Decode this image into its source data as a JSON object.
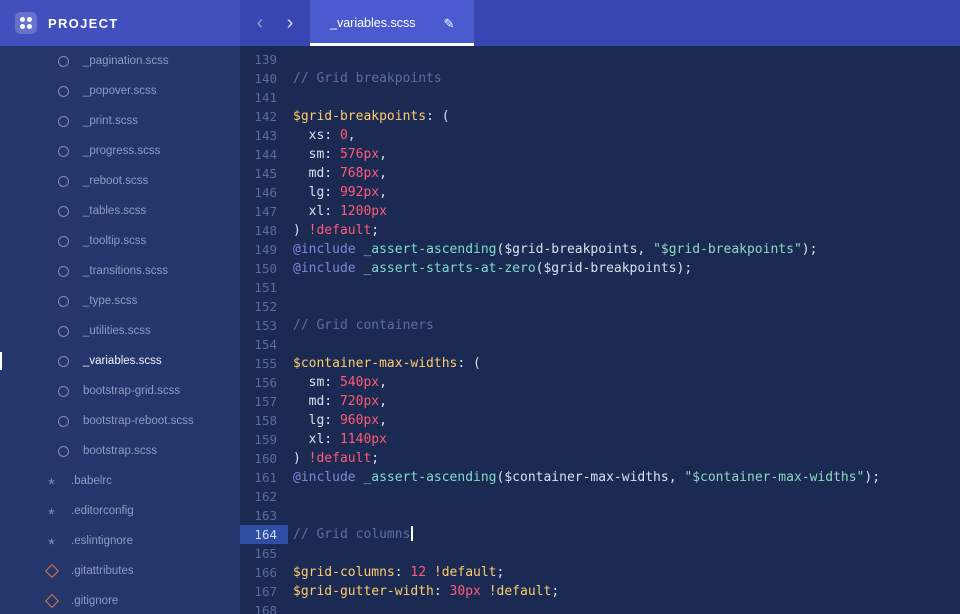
{
  "colors": {
    "header_left_bg": "#4250BE",
    "header_right_bg": "#3945B0",
    "active_tab_bg": "#4C5AD0",
    "tab_underline": "#FFFFFF",
    "sidebar_bg": "#24366B",
    "editor_bg": "#1B2A52",
    "active_line_gutter_bg": "#2E4DA3",
    "syntax_comment": "#5C6E9E",
    "syntax_variable": "#FFCB6B",
    "syntax_number": "#FF5B76",
    "syntax_atrule": "#7C88E0",
    "syntax_function": "#7FDBCA",
    "syntax_string": "#8FD7C2",
    "git_icon_color": "#D97745"
  },
  "header": {
    "project_label": "PROJECT",
    "back_icon": "‹",
    "forward_icon": "›",
    "tab_label": "_variables.scss",
    "pencil_icon": "✎"
  },
  "sidebar": {
    "files": [
      {
        "name": "_pagination.scss",
        "icon": "sass-icon",
        "depth": 1,
        "active": false
      },
      {
        "name": "_popover.scss",
        "icon": "sass-icon",
        "depth": 1,
        "active": false
      },
      {
        "name": "_print.scss",
        "icon": "sass-icon",
        "depth": 1,
        "active": false
      },
      {
        "name": "_progress.scss",
        "icon": "sass-icon",
        "depth": 1,
        "active": false
      },
      {
        "name": "_reboot.scss",
        "icon": "sass-icon",
        "depth": 1,
        "active": false
      },
      {
        "name": "_tables.scss",
        "icon": "sass-icon",
        "depth": 1,
        "active": false
      },
      {
        "name": "_tooltip.scss",
        "icon": "sass-icon",
        "depth": 1,
        "active": false
      },
      {
        "name": "_transitions.scss",
        "icon": "sass-icon",
        "depth": 1,
        "active": false
      },
      {
        "name": "_type.scss",
        "icon": "sass-icon",
        "depth": 1,
        "active": false
      },
      {
        "name": "_utilities.scss",
        "icon": "sass-icon",
        "depth": 1,
        "active": false
      },
      {
        "name": "_variables.scss",
        "icon": "sass-icon",
        "depth": 1,
        "active": true
      },
      {
        "name": "bootstrap-grid.scss",
        "icon": "sass-icon",
        "depth": 1,
        "active": false
      },
      {
        "name": "bootstrap-reboot.scss",
        "icon": "sass-icon",
        "depth": 1,
        "active": false
      },
      {
        "name": "bootstrap.scss",
        "icon": "sass-icon",
        "depth": 1,
        "active": false
      },
      {
        "name": ".babelrc",
        "icon": "asterisk-icon",
        "depth": 0,
        "active": false
      },
      {
        "name": ".editorconfig",
        "icon": "asterisk-icon",
        "depth": 0,
        "active": false
      },
      {
        "name": ".eslintignore",
        "icon": "asterisk-icon",
        "depth": 0,
        "active": false
      },
      {
        "name": ".gitattributes",
        "icon": "git-icon",
        "depth": 0,
        "active": false
      },
      {
        "name": ".gitignore",
        "icon": "git-icon",
        "depth": 0,
        "active": false
      }
    ]
  },
  "editor": {
    "active_line": 164,
    "lines": [
      {
        "n": 139,
        "tokens": []
      },
      {
        "n": 140,
        "tokens": [
          {
            "text": "// Grid breakpoints",
            "style": "comment"
          }
        ]
      },
      {
        "n": 141,
        "tokens": []
      },
      {
        "n": 142,
        "tokens": [
          {
            "text": "$grid-breakpoints",
            "style": "var"
          },
          {
            "text": ": (",
            "style": "plain"
          }
        ]
      },
      {
        "n": 143,
        "tokens": [
          {
            "text": "  xs: ",
            "style": "plain"
          },
          {
            "text": "0",
            "style": "num"
          },
          {
            "text": ",",
            "style": "plain"
          }
        ]
      },
      {
        "n": 144,
        "tokens": [
          {
            "text": "  sm: ",
            "style": "plain"
          },
          {
            "text": "576px",
            "style": "num"
          },
          {
            "text": ",",
            "style": "plain"
          }
        ]
      },
      {
        "n": 145,
        "tokens": [
          {
            "text": "  md: ",
            "style": "plain"
          },
          {
            "text": "768px",
            "style": "num"
          },
          {
            "text": ",",
            "style": "plain"
          }
        ]
      },
      {
        "n": 146,
        "tokens": [
          {
            "text": "  lg: ",
            "style": "plain"
          },
          {
            "text": "992px",
            "style": "num"
          },
          {
            "text": ",",
            "style": "plain"
          }
        ]
      },
      {
        "n": 147,
        "tokens": [
          {
            "text": "  xl: ",
            "style": "plain"
          },
          {
            "text": "1200px",
            "style": "num"
          }
        ]
      },
      {
        "n": 148,
        "tokens": [
          {
            "text": ") ",
            "style": "plain"
          },
          {
            "text": "!default",
            "style": "bang"
          },
          {
            "text": ";",
            "style": "plain"
          }
        ]
      },
      {
        "n": 149,
        "tokens": [
          {
            "text": "@include",
            "style": "at"
          },
          {
            "text": " ",
            "style": "plain"
          },
          {
            "text": "_assert-ascending",
            "style": "fn"
          },
          {
            "text": "(",
            "style": "plain"
          },
          {
            "text": "$grid-breakpoints",
            "style": "plain"
          },
          {
            "text": ", ",
            "style": "plain"
          },
          {
            "text": "\"$grid-breakpoints\"",
            "style": "str"
          },
          {
            "text": ");",
            "style": "plain"
          }
        ]
      },
      {
        "n": 150,
        "tokens": [
          {
            "text": "@include",
            "style": "at"
          },
          {
            "text": " ",
            "style": "plain"
          },
          {
            "text": "_assert-starts-at-zero",
            "style": "fn"
          },
          {
            "text": "($grid-breakpoints);",
            "style": "plain"
          }
        ]
      },
      {
        "n": 151,
        "tokens": []
      },
      {
        "n": 152,
        "tokens": []
      },
      {
        "n": 153,
        "tokens": [
          {
            "text": "// Grid containers",
            "style": "comment"
          }
        ]
      },
      {
        "n": 154,
        "tokens": []
      },
      {
        "n": 155,
        "tokens": [
          {
            "text": "$container-max-widths",
            "style": "var"
          },
          {
            "text": ": (",
            "style": "plain"
          }
        ]
      },
      {
        "n": 156,
        "tokens": [
          {
            "text": "  sm: ",
            "style": "plain"
          },
          {
            "text": "540px",
            "style": "num"
          },
          {
            "text": ",",
            "style": "plain"
          }
        ]
      },
      {
        "n": 157,
        "tokens": [
          {
            "text": "  md: ",
            "style": "plain"
          },
          {
            "text": "720px",
            "style": "num"
          },
          {
            "text": ",",
            "style": "plain"
          }
        ]
      },
      {
        "n": 158,
        "tokens": [
          {
            "text": "  lg: ",
            "style": "plain"
          },
          {
            "text": "960px",
            "style": "num"
          },
          {
            "text": ",",
            "style": "plain"
          }
        ]
      },
      {
        "n": 159,
        "tokens": [
          {
            "text": "  xl: ",
            "style": "plain"
          },
          {
            "text": "1140px",
            "style": "num"
          }
        ]
      },
      {
        "n": 160,
        "tokens": [
          {
            "text": ") ",
            "style": "plain"
          },
          {
            "text": "!default",
            "style": "bang"
          },
          {
            "text": ";",
            "style": "plain"
          }
        ]
      },
      {
        "n": 161,
        "tokens": [
          {
            "text": "@include",
            "style": "at"
          },
          {
            "text": " ",
            "style": "plain"
          },
          {
            "text": "_assert-ascending",
            "style": "fn"
          },
          {
            "text": "(",
            "style": "plain"
          },
          {
            "text": "$container-max-widths",
            "style": "plain"
          },
          {
            "text": ", ",
            "style": "plain"
          },
          {
            "text": "\"$container-max-widths\"",
            "style": "str"
          },
          {
            "text": ");",
            "style": "plain"
          }
        ]
      },
      {
        "n": 162,
        "tokens": []
      },
      {
        "n": 163,
        "tokens": []
      },
      {
        "n": 164,
        "tokens": [
          {
            "text": "// Grid columns",
            "style": "comment"
          }
        ],
        "cursor": true
      },
      {
        "n": 165,
        "tokens": []
      },
      {
        "n": 166,
        "tokens": [
          {
            "text": "$grid-columns",
            "style": "var"
          },
          {
            "text": ": ",
            "style": "plain"
          },
          {
            "text": "12",
            "style": "num"
          },
          {
            "text": " ",
            "style": "plain"
          },
          {
            "text": "!default",
            "style": "bangy"
          },
          {
            "text": ";",
            "style": "plain"
          }
        ]
      },
      {
        "n": 167,
        "tokens": [
          {
            "text": "$grid-gutter-width",
            "style": "var"
          },
          {
            "text": ": ",
            "style": "plain"
          },
          {
            "text": "30px",
            "style": "num"
          },
          {
            "text": " ",
            "style": "plain"
          },
          {
            "text": "!default",
            "style": "bangy"
          },
          {
            "text": ";",
            "style": "plain"
          }
        ]
      },
      {
        "n": 168,
        "tokens": []
      }
    ]
  }
}
